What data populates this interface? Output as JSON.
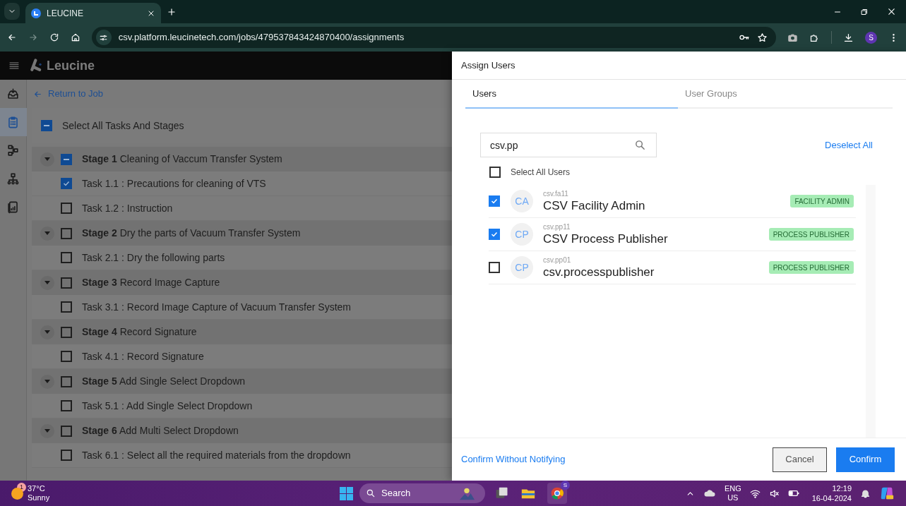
{
  "browser": {
    "tab_title": "LEUCINE",
    "url": "csv.platform.leucinetech.com/jobs/479537843424870400/assignments",
    "profile": "S"
  },
  "app": {
    "logo": "Leucine",
    "back_link": "Return to Job",
    "select_all": {
      "label": "Select All Tasks And Stages",
      "indeterminate": true
    },
    "stages": [
      {
        "title": "**Stage 1** Cleaning of Vaccum Transfer System",
        "indeterminate": true,
        "expanded": true,
        "children": [
          {
            "title": "Task 1.1 : Precautions for cleaning of VTS",
            "checked": true
          },
          {
            "title": "Task 1.2 : Instruction",
            "checked": false
          }
        ]
      },
      {
        "title": "**Stage 2** Dry the parts of Vacuum Transfer System",
        "checked": false,
        "indeterminate": false,
        "expanded": true,
        "children": [
          {
            "title": "Task 2.1 : Dry the following parts",
            "checked": false
          }
        ]
      },
      {
        "title": "**Stage 3** Record Image Capture",
        "checked": false,
        "indeterminate": false,
        "expanded": true,
        "children": [
          {
            "title": "Task 3.1 : Record Image Capture of Vacuum Transfer System",
            "checked": false
          }
        ]
      },
      {
        "title": "**Stage 4** Record Signature",
        "checked": false,
        "indeterminate": false,
        "expanded": true,
        "children": [
          {
            "title": "Task 4.1 : Record Signature",
            "checked": false
          }
        ]
      },
      {
        "title": "**Stage 5** Add Single Select Dropdown",
        "checked": false,
        "indeterminate": false,
        "expanded": true,
        "children": [
          {
            "title": "Task 5.1 : Add Single Select Dropdown",
            "checked": false
          }
        ]
      },
      {
        "title": "**Stage 6** Add Multi Select Dropdown",
        "checked": false,
        "indeterminate": false,
        "expanded": true,
        "children": [
          {
            "title": "Task 6.1 : Select all the required materials from the dropdown",
            "checked": false
          }
        ]
      }
    ]
  },
  "drawer": {
    "title": "Assign Users",
    "tabs": [
      {
        "label": "Users",
        "selected": true
      },
      {
        "label": "User Groups",
        "selected": false
      }
    ],
    "search": {
      "value": "csv.pp"
    },
    "deselect_all": "Deselect All",
    "select_all_users": {
      "label": "Select All Users",
      "checked": false
    },
    "users": [
      {
        "initials": "CA",
        "username": "csv.fa11",
        "name": "CSV Facility Admin",
        "role": "FACILITY ADMIN",
        "checked": true
      },
      {
        "initials": "CP",
        "username": "csv.pp11",
        "name": "CSV Process Publisher",
        "role": "PROCESS PUBLISHER",
        "checked": true
      },
      {
        "initials": "CP",
        "username": "csv.pp01",
        "name": "csv.processpublisher",
        "role": "PROCESS PUBLISHER",
        "checked": false
      }
    ],
    "confirm_without_notifying": "Confirm Without Notifying",
    "buttons": [
      {
        "label": "Cancel",
        "kind": "secondary"
      },
      {
        "label": "Confirm",
        "kind": "primary"
      }
    ]
  },
  "taskbar": {
    "weather": {
      "temp": "37°C",
      "condition": "Sunny",
      "badge": "1"
    },
    "search": "Search",
    "chrome_badge": "S",
    "language": "ENG",
    "region": "US",
    "time": "12:19",
    "date": "16-04-2024"
  }
}
